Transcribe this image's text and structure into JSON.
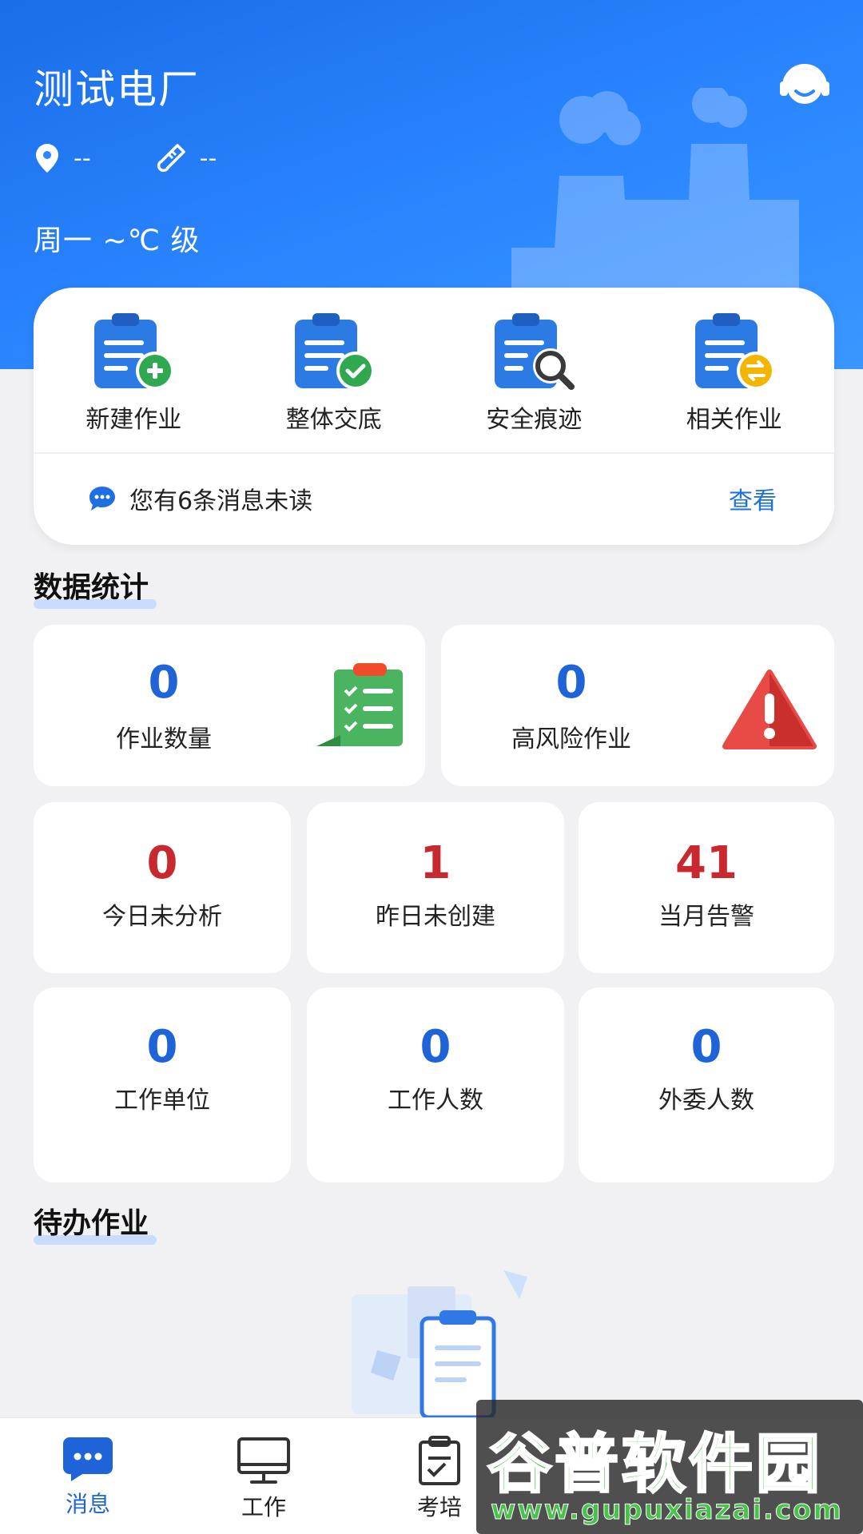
{
  "header": {
    "plant_name": "测试电厂",
    "location_value": "--",
    "temperature_value": "--",
    "weather_line": "周一 ~℃ 级"
  },
  "quick_actions": [
    {
      "label": "新建作业",
      "icon": "clipboard-add-icon",
      "badge_color": "#2fa84f"
    },
    {
      "label": "整体交底",
      "icon": "clipboard-check-icon",
      "badge_color": "#2fa84f"
    },
    {
      "label": "安全痕迹",
      "icon": "clipboard-search-icon",
      "badge_color": "#3a3a3a"
    },
    {
      "label": "相关作业",
      "icon": "clipboard-exchange-icon",
      "badge_color": "#f2b500"
    }
  ],
  "messages": {
    "unread_text": "您有6条消息未读",
    "view_label": "查看"
  },
  "data_stats": {
    "title": "数据统计",
    "top": [
      {
        "value": "0",
        "label": "作业数量",
        "icon": "checklist-icon"
      },
      {
        "value": "0",
        "label": "高风险作业",
        "icon": "warning-triangle-icon"
      }
    ],
    "middle": [
      {
        "value": "0",
        "label": "今日未分析",
        "color": "red"
      },
      {
        "value": "1",
        "label": "昨日未创建",
        "color": "red"
      },
      {
        "value": "41",
        "label": "当月告警",
        "color": "red"
      }
    ],
    "bottom": [
      {
        "value": "0",
        "label": "工作单位",
        "color": "blue"
      },
      {
        "value": "0",
        "label": "工作人数",
        "color": "blue"
      },
      {
        "value": "0",
        "label": "外委人数",
        "color": "blue"
      }
    ]
  },
  "pending": {
    "title": "待办作业"
  },
  "tabbar": [
    {
      "label": "消息",
      "icon": "chat-bubble-icon",
      "active": true
    },
    {
      "label": "工作",
      "icon": "monitor-icon",
      "active": false
    },
    {
      "label": "考培",
      "icon": "clipboard-icon",
      "active": false
    }
  ],
  "watermark": {
    "name": "谷普软件园",
    "url": "www.gupuxiazai.com"
  },
  "colors": {
    "primary_blue": "#1e63d8",
    "header_blue": "#2b86ff",
    "alert_red": "#c8292e"
  }
}
